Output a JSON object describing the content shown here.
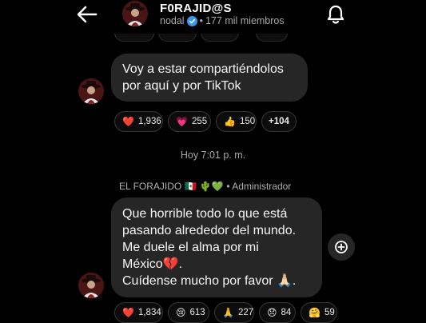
{
  "header": {
    "title": "F0RAJID@S",
    "handle": "nodal",
    "members": "177 mil miembros",
    "separator": "•"
  },
  "messages": [
    {
      "text": "Voy a estar compartiéndolos por aquí y por TikTok",
      "reactions": [
        {
          "emoji": "❤️",
          "count": "1,936"
        },
        {
          "emoji": "💗",
          "count": "255"
        },
        {
          "emoji": "👍",
          "count": "150"
        },
        {
          "emoji": "",
          "count": "+104"
        }
      ]
    },
    {
      "sender_name": "EL FORAJIDO",
      "sender_emojis": "🇲🇽 🌵💚",
      "sender_role": "• Administrador",
      "lines": [
        "Que horrible todo lo que está",
        "pasando alrededor del mundo.",
        "Me duele el alma por mi",
        "México💔.",
        "Cuídense mucho por favor 🙏🏻."
      ],
      "reactions": [
        {
          "emoji": "❤️",
          "count": "1,834"
        },
        {
          "emoji": "😢",
          "count": "613"
        },
        {
          "emoji": "🙏",
          "count": "227"
        },
        {
          "emoji": "😞",
          "count": "84"
        },
        {
          "emoji": "🤗",
          "count": "59"
        }
      ]
    }
  ],
  "timestamp": "Hoy 7:01 p. m.",
  "icons": {
    "back": "back-arrow-icon",
    "bell": "bell-icon",
    "verified": "verified-badge-icon",
    "add_reaction": "add-reaction-icon"
  },
  "colors": {
    "background": "#000000",
    "bubble": "#262626",
    "verified": "#3897f0",
    "secondary_text": "#a8a8a8"
  }
}
